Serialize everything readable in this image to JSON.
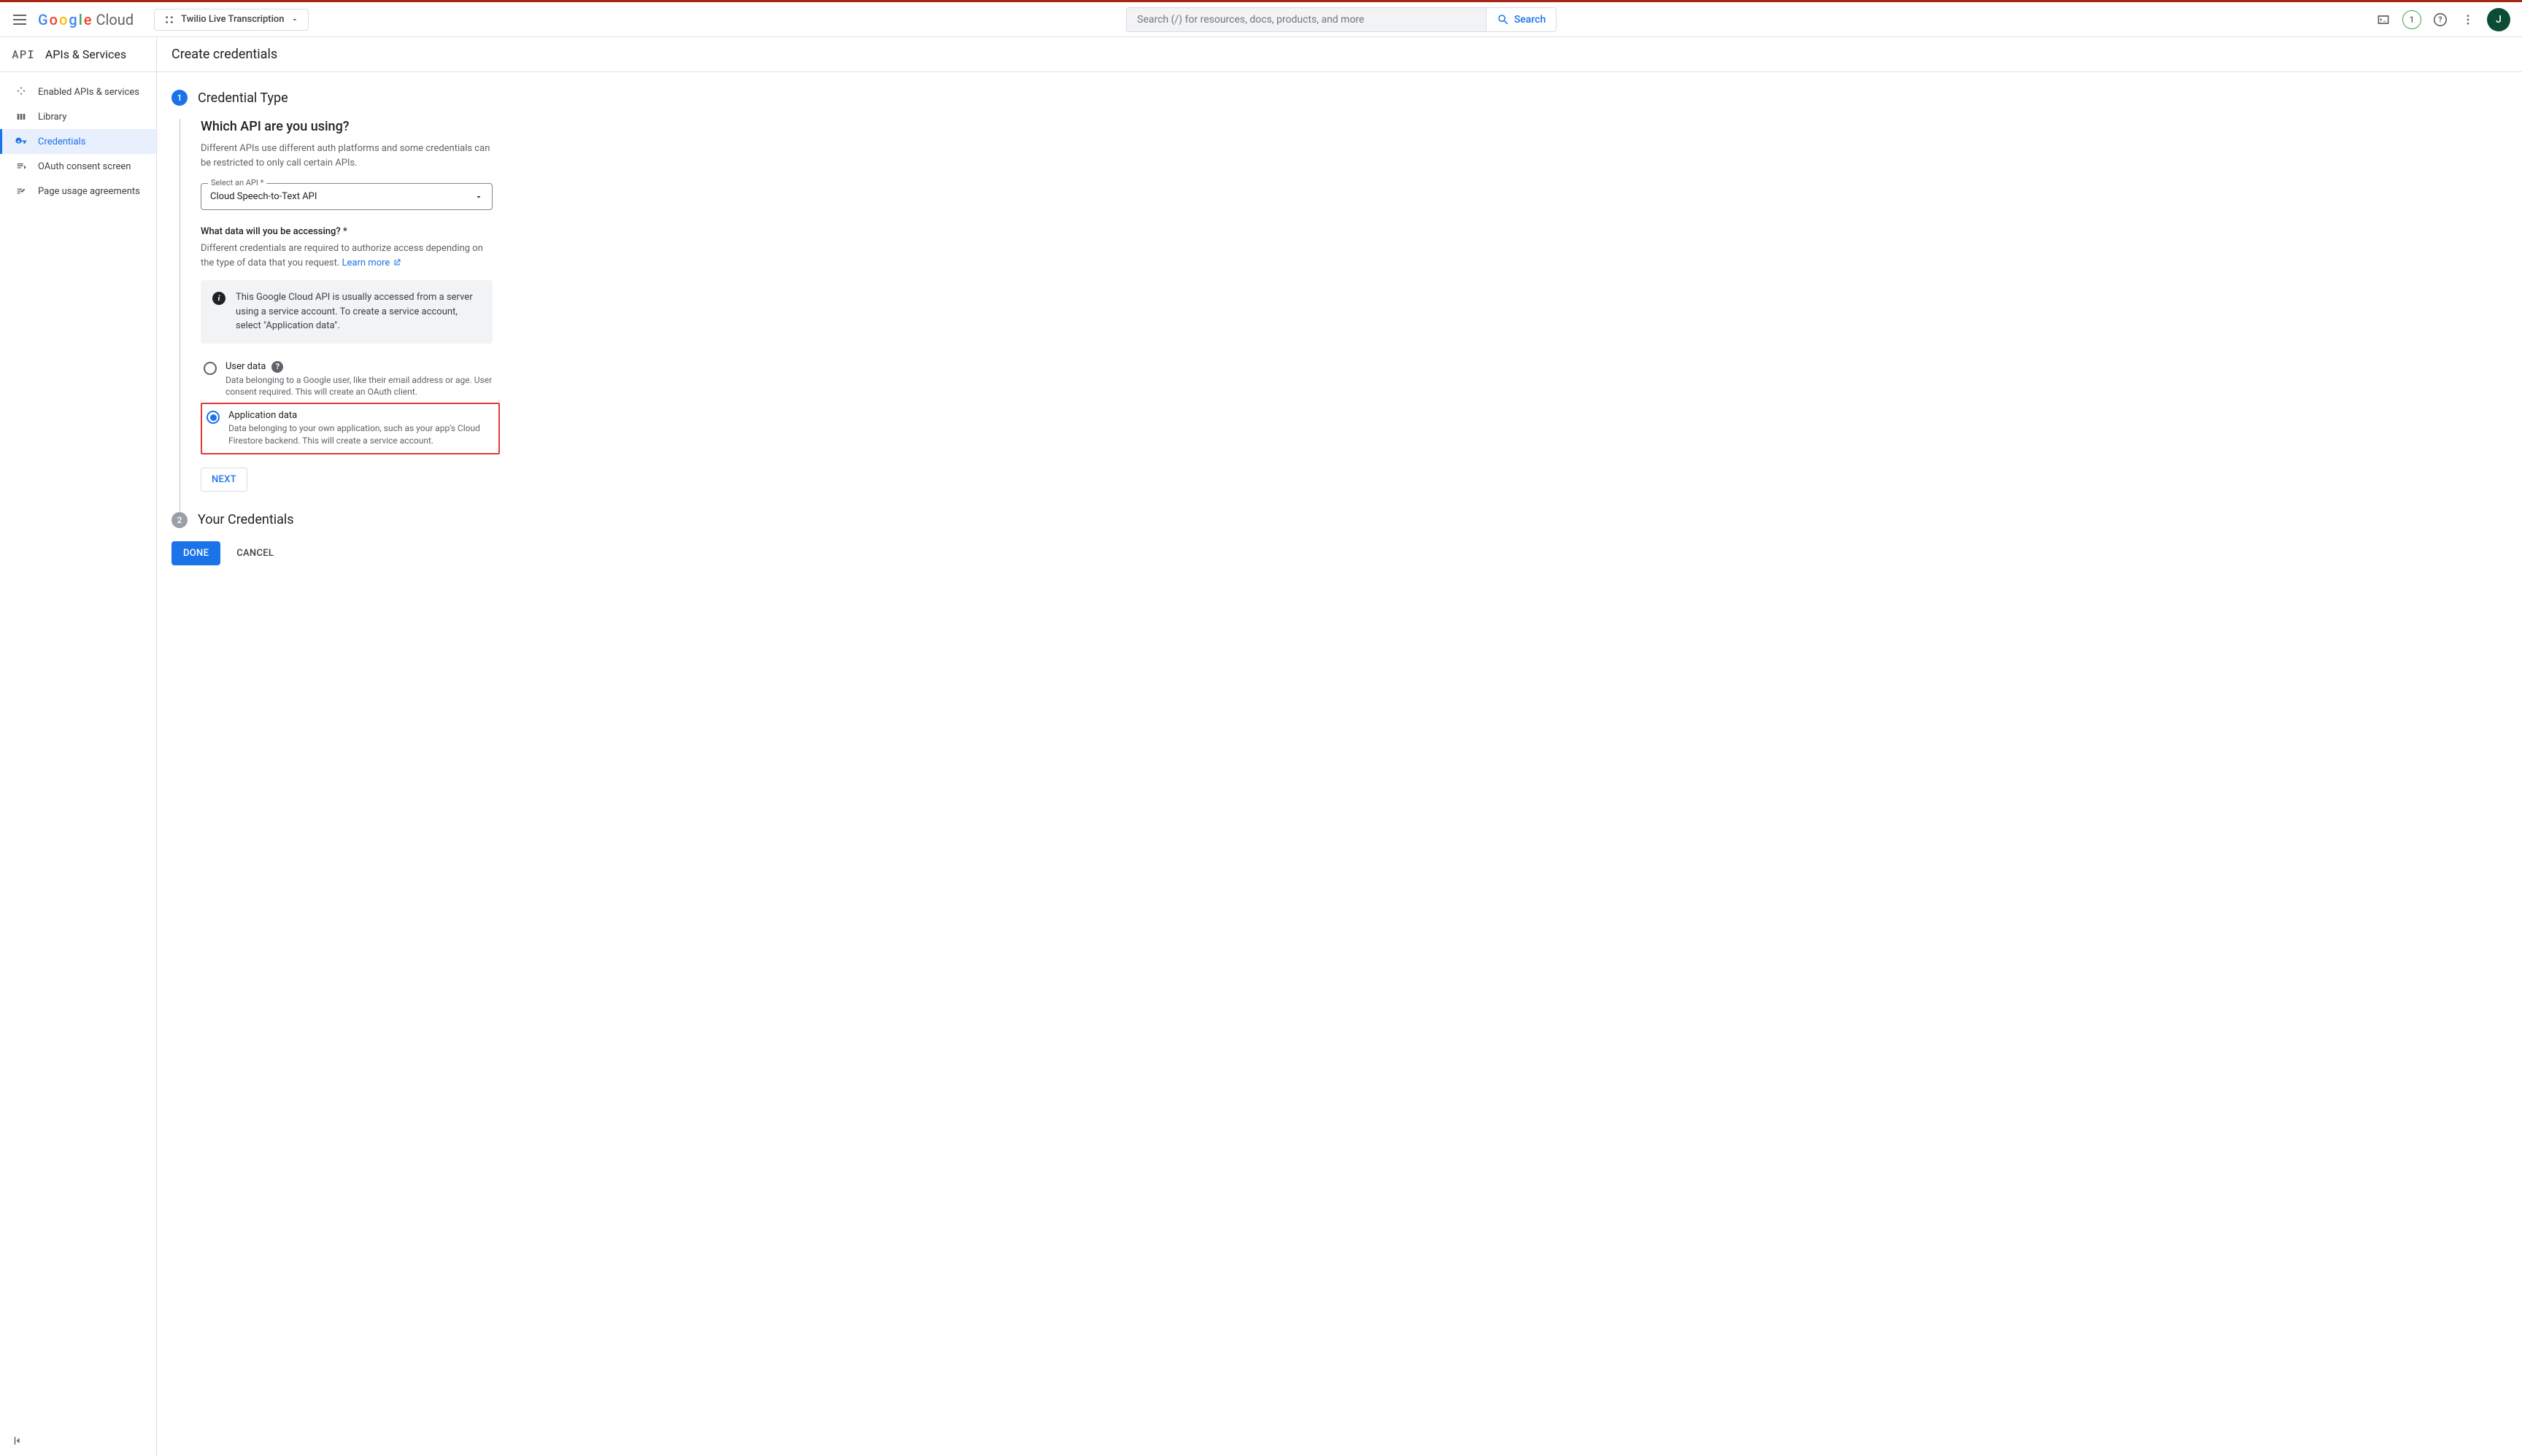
{
  "header": {
    "logo_cloud": "Cloud",
    "project_name": "Twilio Live Transcription",
    "search_placeholder": "Search (/) for resources, docs, products, and more",
    "search_button": "Search",
    "badge_count": "1",
    "avatar_initial": "J"
  },
  "subheader": {
    "section_title": "APIs & Services",
    "page_title": "Create credentials"
  },
  "sidebar": {
    "items": [
      {
        "label": "Enabled APIs & services"
      },
      {
        "label": "Library"
      },
      {
        "label": "Credentials"
      },
      {
        "label": "OAuth consent screen"
      },
      {
        "label": "Page usage agreements"
      }
    ]
  },
  "wizard": {
    "step1_num": "1",
    "step1_title": "Credential Type",
    "step2_num": "2",
    "step2_title": "Your Credentials",
    "q_api": "Which API are you using?",
    "q_api_helper": "Different APIs use different auth platforms and some credentials can be restricted to only call certain APIs.",
    "api_field_label": "Select an API *",
    "api_selected": "Cloud Speech-to-Text API",
    "q_data": "What data will you be accessing? *",
    "q_data_helper": "Different credentials are required to authorize access depending on the type of data that you request. ",
    "learn_more": "Learn more",
    "info_text": "This Google Cloud API is usually accessed from a server using a service account. To create a service account, select \"Application data\".",
    "radio_user_label": "User data",
    "radio_user_desc": "Data belonging to a Google user, like their email address or age. User consent required. This will create an OAuth client.",
    "radio_app_label": "Application data",
    "radio_app_desc": "Data belonging to your own application, such as your app's Cloud Firestore backend. This will create a service account.",
    "next_btn": "NEXT",
    "done_btn": "DONE",
    "cancel_btn": "CANCEL"
  }
}
